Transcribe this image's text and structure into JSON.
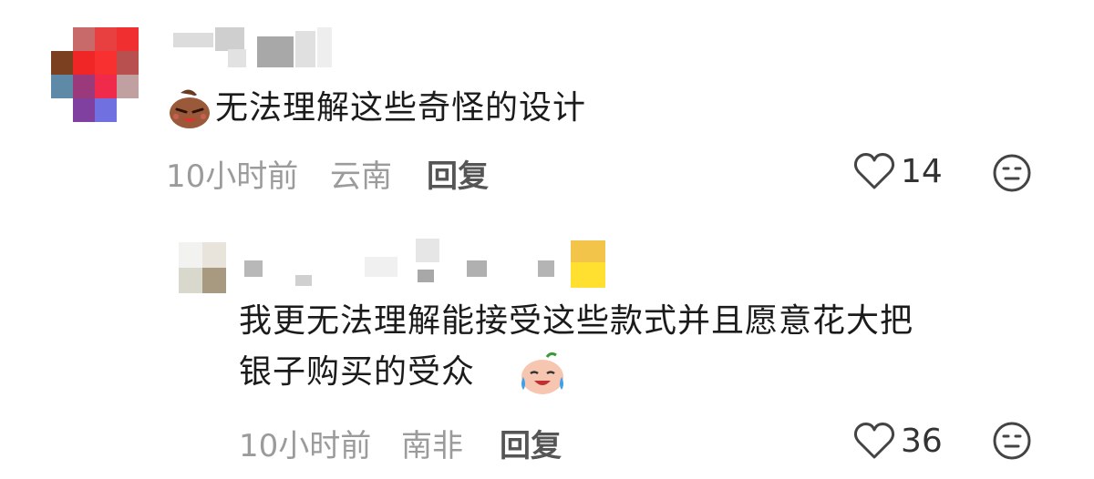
{
  "comments": [
    {
      "text": "无法理解这些奇怪的设计",
      "time": "10小时前",
      "location": "云南",
      "reply_label": "回复",
      "likes": "14"
    },
    {
      "text_line1": "我更无法理解能接受这些款式并且愿意花大把",
      "text_line2": "银子购买的受众",
      "time": "10小时前",
      "location": "南非",
      "reply_label": "回复",
      "likes": "36"
    }
  ],
  "icons": {
    "like": "heart-outline-icon",
    "react": "smiley-face-icon",
    "emoji1": "angry-brown-face-emoji",
    "emoji2": "crying-laughing-face-emoji"
  },
  "colors": {
    "meta": "#9b9b9b",
    "reply": "#555555",
    "icon": "#444444"
  }
}
